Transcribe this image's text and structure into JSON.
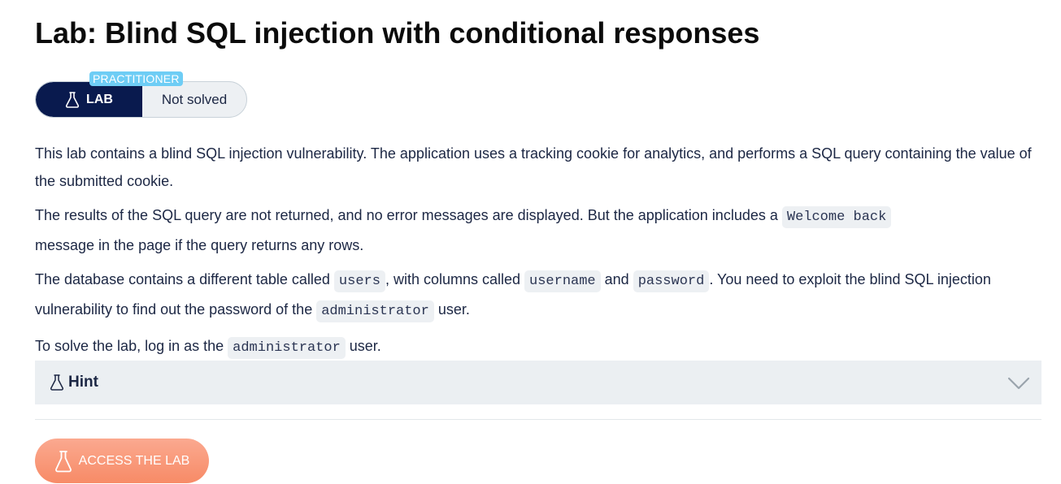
{
  "page": {
    "title": "Lab: Blind SQL injection with conditional responses"
  },
  "badge": {
    "level": "PRACTITIONER",
    "lab_label": "LAB",
    "status": "Not solved"
  },
  "description": {
    "p1": "This lab contains a blind SQL injection vulnerability. The application uses a tracking cookie for analytics, and performs a SQL query containing the value of the submitted cookie.",
    "p2_before": "The results of the SQL query are not returned, and no error messages are displayed. But the application includes a ",
    "p2_code": "Welcome back",
    "p2_after": " message in the page if the query returns any rows.",
    "p3_a": "The database contains a different table called ",
    "p3_code1": "users",
    "p3_b": ", with columns called ",
    "p3_code2": "username",
    "p3_c": " and ",
    "p3_code3": "password",
    "p3_d": ". You need to exploit the blind SQL injection vulnerability to find out the password of the ",
    "p3_code4": "administrator",
    "p3_e": " user.",
    "p4_a": "To solve the lab, log in as the ",
    "p4_code": "administrator",
    "p4_b": " user."
  },
  "hint": {
    "label": "Hint"
  },
  "access_button": {
    "label": "ACCESS THE LAB"
  },
  "colors": {
    "badge_dark": "#091a4e",
    "level_tag": "#6ecdf5",
    "access_button": "#f7855f"
  },
  "icons": {
    "lab": "flask-icon",
    "hint": "flask-icon",
    "expand": "chevron-down-icon"
  }
}
